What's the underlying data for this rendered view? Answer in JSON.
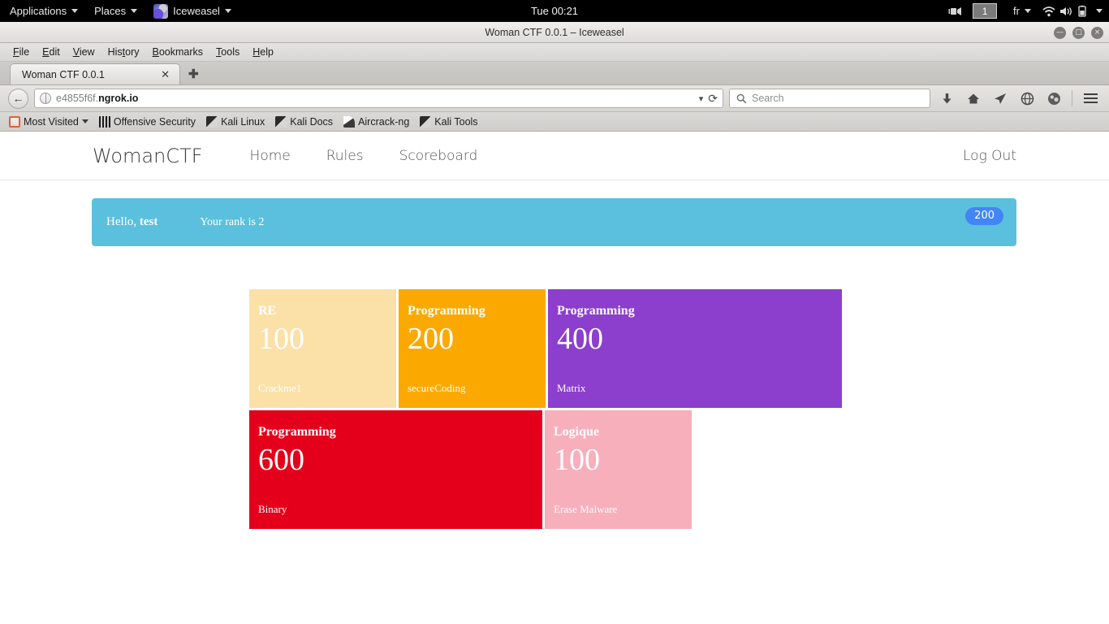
{
  "os_panel": {
    "applications_label": "Applications",
    "places_label": "Places",
    "app_window_label": "Iceweasel",
    "clock": "Tue 00:21",
    "workspace": "1",
    "keyboard_layout": "fr",
    "icons": {
      "screencast": "screencast-icon",
      "wifi": "wifi-icon",
      "volume": "volume-icon",
      "battery": "battery-icon",
      "system-menu": "chevron-down-icon"
    }
  },
  "window": {
    "title": "Woman CTF 0.0.1 – Iceweasel",
    "minimize": "—",
    "maximize": "□",
    "close": "×"
  },
  "menubar": [
    {
      "label": "File",
      "mnemonic": "F",
      "rest": "ile"
    },
    {
      "label": "Edit",
      "mnemonic": "E",
      "rest": "dit"
    },
    {
      "label": "View",
      "mnemonic": "V",
      "rest": "iew"
    },
    {
      "label": "History",
      "mnemonic": "t",
      "pre": "His",
      "rest": "ory"
    },
    {
      "label": "Bookmarks",
      "mnemonic": "B",
      "rest": "ookmarks"
    },
    {
      "label": "Tools",
      "mnemonic": "T",
      "rest": "ools"
    },
    {
      "label": "Help",
      "mnemonic": "H",
      "rest": "elp"
    }
  ],
  "tabs": {
    "active_tab_title": "Woman CTF 0.0.1",
    "close_glyph": "✕",
    "new_tab_glyph": "✚"
  },
  "toolbar": {
    "back_glyph": "←",
    "url_prefix": "e4855f6f.",
    "url_domain": "ngrok.io",
    "url_full": "e4855f6f.ngrok.io",
    "dropdown_glyph": "▾",
    "reload_glyph": "⟳",
    "search_placeholder": "Search",
    "search_value": "",
    "download_glyph": "⬇",
    "home_glyph": "⌂",
    "share_glyph": "➤",
    "globe_glyph": "🌐",
    "profile_glyph": "◉"
  },
  "bookmarks": [
    {
      "label": "Most Visited",
      "icon": "most-visited-icon",
      "has_caret": true
    },
    {
      "label": "Offensive Security",
      "icon": "offensive-security-icon",
      "has_caret": false
    },
    {
      "label": "Kali Linux",
      "icon": "kali-dragon-icon",
      "has_caret": false
    },
    {
      "label": "Kali Docs",
      "icon": "kali-dragon-icon",
      "has_caret": false
    },
    {
      "label": "Aircrack-ng",
      "icon": "aircrack-icon",
      "has_caret": false
    },
    {
      "label": "Kali Tools",
      "icon": "kali-dragon-icon",
      "has_caret": false
    }
  ],
  "site": {
    "brand": "WomanCTF",
    "nav": [
      {
        "label": "Home"
      },
      {
        "label": "Rules"
      },
      {
        "label": "Scoreboard"
      }
    ],
    "logout_label": "Log Out",
    "alert": {
      "greeting_prefix": "Hello, ",
      "username": "test",
      "rank_text": "Your rank is 2",
      "score": "200",
      "background": "#5bc0de",
      "badge_color": "#4285f4"
    },
    "challenges": [
      {
        "category": "RE",
        "points": "100",
        "name": "Crackme1",
        "color": "#fbe0a8",
        "solved": true,
        "width": "w-small"
      },
      {
        "category": "Programming",
        "points": "200",
        "name": "secureCoding",
        "color": "#fba900",
        "solved": false,
        "width": "w-medium"
      },
      {
        "category": "Programming",
        "points": "400",
        "name": "Matrix",
        "color": "#8b3fcc",
        "solved": false,
        "width": "w-large"
      },
      {
        "category": "Programming",
        "points": "600",
        "name": "Binary",
        "color": "#e4001b",
        "solved": false,
        "width": "w-xl"
      },
      {
        "category": "Logique",
        "points": "100",
        "name": "Erase Malware",
        "color": "#f7afbc",
        "solved": true,
        "width": "w-medium"
      }
    ]
  }
}
